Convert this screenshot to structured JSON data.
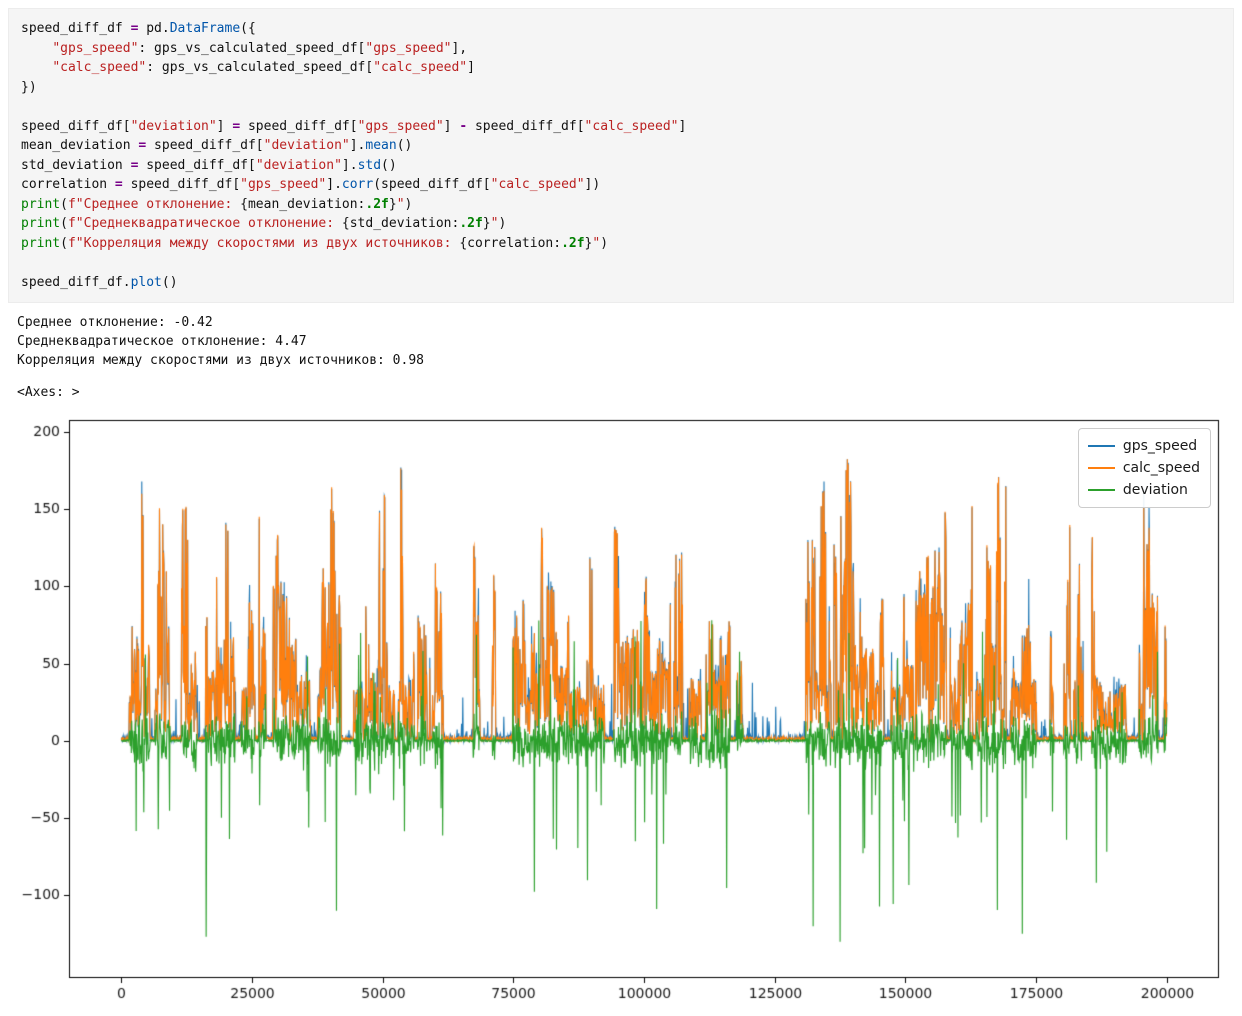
{
  "cell": {
    "code_lines": [
      [
        [
          "p",
          "speed_diff_df "
        ],
        [
          "o",
          "="
        ],
        [
          "p",
          " pd."
        ],
        [
          "m",
          "DataFrame"
        ],
        [
          "p",
          "({"
        ]
      ],
      [
        [
          "p",
          "    "
        ],
        [
          "s",
          "\"gps_speed\""
        ],
        [
          "p",
          ": gps_vs_calculated_speed_df["
        ],
        [
          "s",
          "\"gps_speed\""
        ],
        [
          "p",
          "],"
        ]
      ],
      [
        [
          "p",
          "    "
        ],
        [
          "s",
          "\"calc_speed\""
        ],
        [
          "p",
          ": gps_vs_calculated_speed_df["
        ],
        [
          "s",
          "\"calc_speed\""
        ],
        [
          "p",
          "]"
        ]
      ],
      [
        [
          "p",
          "})"
        ]
      ],
      [],
      [
        [
          "p",
          "speed_diff_df["
        ],
        [
          "s",
          "\"deviation\""
        ],
        [
          "p",
          "] "
        ],
        [
          "o",
          "="
        ],
        [
          "p",
          " speed_diff_df["
        ],
        [
          "s",
          "\"gps_speed\""
        ],
        [
          "p",
          "] "
        ],
        [
          "o",
          "-"
        ],
        [
          "p",
          " speed_diff_df["
        ],
        [
          "s",
          "\"calc_speed\""
        ],
        [
          "p",
          "]"
        ]
      ],
      [
        [
          "p",
          "mean_deviation "
        ],
        [
          "o",
          "="
        ],
        [
          "p",
          " speed_diff_df["
        ],
        [
          "s",
          "\"deviation\""
        ],
        [
          "p",
          "]."
        ],
        [
          "m",
          "mean"
        ],
        [
          "p",
          "()"
        ]
      ],
      [
        [
          "p",
          "std_deviation "
        ],
        [
          "o",
          "="
        ],
        [
          "p",
          " speed_diff_df["
        ],
        [
          "s",
          "\"deviation\""
        ],
        [
          "p",
          "]."
        ],
        [
          "m",
          "std"
        ],
        [
          "p",
          "()"
        ]
      ],
      [
        [
          "p",
          "correlation "
        ],
        [
          "o",
          "="
        ],
        [
          "p",
          " speed_diff_df["
        ],
        [
          "s",
          "\"gps_speed\""
        ],
        [
          "p",
          "]."
        ],
        [
          "m",
          "corr"
        ],
        [
          "p",
          "(speed_diff_df["
        ],
        [
          "s",
          "\"calc_speed\""
        ],
        [
          "p",
          "])"
        ]
      ],
      [
        [
          "b",
          "print"
        ],
        [
          "p",
          "("
        ],
        [
          "s",
          "f\"Среднее отклонение: "
        ],
        [
          "p",
          "{mean_deviation:"
        ],
        [
          "n",
          ".2f"
        ],
        [
          "p",
          "}"
        ],
        [
          "s",
          "\""
        ],
        [
          "p",
          ")"
        ]
      ],
      [
        [
          "b",
          "print"
        ],
        [
          "p",
          "("
        ],
        [
          "s",
          "f\"Среднеквадратическое отклонение: "
        ],
        [
          "p",
          "{std_deviation:"
        ],
        [
          "n",
          ".2f"
        ],
        [
          "p",
          "}"
        ],
        [
          "s",
          "\""
        ],
        [
          "p",
          ")"
        ]
      ],
      [
        [
          "b",
          "print"
        ],
        [
          "p",
          "("
        ],
        [
          "s",
          "f\"Корреляция между скоростями из двух источников: "
        ],
        [
          "p",
          "{correlation:"
        ],
        [
          "n",
          ".2f"
        ],
        [
          "p",
          "}"
        ],
        [
          "s",
          "\""
        ],
        [
          "p",
          ")"
        ]
      ],
      [],
      [
        [
          "p",
          "speed_diff_df."
        ],
        [
          "m",
          "plot"
        ],
        [
          "p",
          "()"
        ]
      ]
    ]
  },
  "outputs": {
    "stdout_lines": [
      "Среднее отклонение: -0.42",
      "Среднеквадратическое отклонение: 4.47",
      "Корреляция между скоростями из двух источников: 0.98"
    ],
    "axes_repr": "<Axes: >"
  },
  "chart_data": {
    "type": "line",
    "title": "",
    "xlabel": "",
    "ylabel": "",
    "x_range_points": [
      0,
      200000
    ],
    "xlim": [
      -10000,
      210000
    ],
    "ylim": [
      -154,
      208
    ],
    "xticks": {
      "values": [
        0,
        25000,
        50000,
        75000,
        100000,
        125000,
        150000,
        175000,
        200000
      ],
      "labels": [
        "0",
        "25000",
        "50000",
        "75000",
        "100000",
        "125000",
        "150000",
        "175000",
        "200000"
      ]
    },
    "yticks": {
      "values": [
        -100,
        -50,
        0,
        50,
        100,
        150,
        200
      ],
      "labels": [
        "−100",
        "−50",
        "0",
        "50",
        "100",
        "150",
        "200"
      ]
    },
    "grid": false,
    "legend_location": "upper right",
    "series": [
      {
        "name": "gps_speed",
        "color": "#1f77b4",
        "approx_value_range": [
          0,
          190
        ],
        "description": "dense noisy speed trace, mostly overlapped by calc_speed with occasional blue tips above it"
      },
      {
        "name": "calc_speed",
        "color": "#ff7f0e",
        "approx_value_range": [
          0,
          190
        ],
        "description": "dense noisy speed trace in bursts (peaks ~50-190) separated by short quiet gaps; correlation with gps_speed 0.98"
      },
      {
        "name": "deviation",
        "color": "#2ca02c",
        "approx_value_range": [
          -132,
          65
        ],
        "description": "gps_speed - calc_speed; centered at 0 (mean -0.42, std 4.47), mostly within ±30 with occasional spikes to ±65 and rare deep negative spikes to about -130"
      }
    ],
    "synthesis": {
      "seed": 1337,
      "n_points": 2600
    }
  }
}
